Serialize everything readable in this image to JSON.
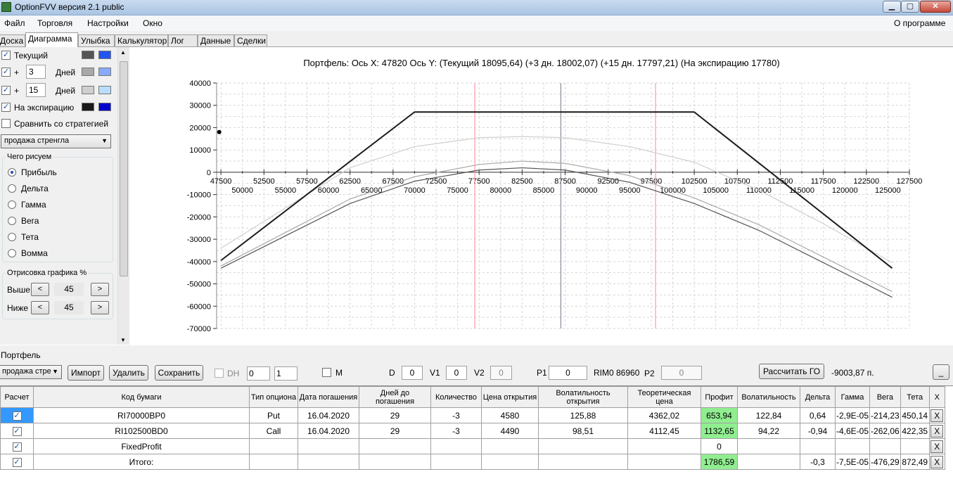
{
  "window": {
    "title": "OptionFVV версия 2.1 public",
    "min_glyph": "▁",
    "max_glyph": "▢",
    "close_glyph": "✕"
  },
  "menu": {
    "items": [
      "Файл",
      "Торговля",
      "Настройки",
      "Окно"
    ],
    "about": "О программе"
  },
  "tabs": [
    "Доска",
    "Диаграмма",
    "Улыбка",
    "Калькулятор",
    "Лог",
    "Данные",
    "Сделки"
  ],
  "active_tab": "Диаграмма",
  "left_panel": {
    "current_label": "Текущий",
    "plus_label": "+",
    "days_label": "Дней",
    "days1": "3",
    "days2": "15",
    "expiry_label": "На экспирацию",
    "compare_label": "Сравнить со стратегией",
    "strategy_value": "продажа стренгла",
    "what_group": "Чего рисуем",
    "options": [
      "Прибыль",
      "Дельта",
      "Гамма",
      "Вега",
      "Тета",
      "Вомма"
    ],
    "selected": "Прибыль",
    "draw_group": "Отрисовка графика %",
    "above_label": "Выше",
    "below_label": "Ниже",
    "above_value": "45",
    "below_value": "45",
    "dec": "<",
    "inc": ">",
    "swatches": {
      "current": [
        "#555555",
        "#2255ee"
      ],
      "d3": [
        "#a8a8a8",
        "#88aaff"
      ],
      "d15": [
        "#cfcfcf",
        "#b8ddff"
      ],
      "expiry": [
        "#1a1a1a",
        "#0000cc"
      ]
    }
  },
  "chart_data": {
    "type": "line",
    "title": "Портфель: Ось X: 47820 Ось Y:  (Текущий 18095,64)  (+3 дн. 18002,07)  (+15 дн. 17797,21)  (На экспирацию 17780)",
    "xlim": [
      47000,
      127500
    ],
    "ylim": [
      -70000,
      40000
    ],
    "grid": true,
    "yticks": [
      40000,
      30000,
      20000,
      10000,
      0,
      -10000,
      -20000,
      -30000,
      -40000,
      -50000,
      -60000,
      -70000
    ],
    "ytick_labels": [
      "40000",
      "30000",
      "20000",
      "10000",
      "0",
      "-10000",
      "-20000",
      "-30000",
      "-40000",
      "-50000",
      "-60000",
      "-70000"
    ],
    "xticks_top": [
      47500,
      52500,
      57500,
      62500,
      67500,
      72500,
      77500,
      82500,
      87500,
      92500,
      97500,
      102500,
      107500,
      112500,
      117500,
      122500,
      127500
    ],
    "xtick_labels_top": [
      "47500",
      "52500",
      "57500",
      "62500",
      "67500",
      "72500",
      "77500",
      "82500",
      "87500",
      "92500",
      "97500",
      "102500",
      "107500",
      "112500",
      "117500",
      "122500",
      "127500"
    ],
    "xticks_bottom": [
      50000,
      55000,
      60000,
      65000,
      70000,
      75000,
      80000,
      85000,
      90000,
      95000,
      100000,
      105000,
      110000,
      115000,
      120000,
      125000
    ],
    "xtick_labels_bottom": [
      "50000",
      "55000",
      "60000",
      "65000",
      "70000",
      "75000",
      "80000",
      "85000",
      "90000",
      "95000",
      "100000",
      "105000",
      "110000",
      "115000",
      "120000",
      "125000"
    ],
    "vlines": [
      {
        "x": 77000,
        "color": "#ff9aa8"
      },
      {
        "x": 87000,
        "color": "#8a8a9a"
      },
      {
        "x": 98000,
        "color": "#ff9aa8"
      }
    ],
    "marker": {
      "x": 47300,
      "y": 18000
    },
    "series": [
      {
        "color": "#1a1a1a",
        "points": [
          [
            47500,
            -39500
          ],
          [
            70000,
            27000
          ],
          [
            102500,
            27000
          ],
          [
            125500,
            -43000
          ]
        ]
      },
      {
        "color": "#555555",
        "points": [
          [
            47500,
            -43000
          ],
          [
            55000,
            -28500
          ],
          [
            62500,
            -14000
          ],
          [
            70000,
            -4000
          ],
          [
            77500,
            1000
          ],
          [
            82500,
            2000
          ],
          [
            87500,
            1000
          ],
          [
            95000,
            -4500
          ],
          [
            102500,
            -14000
          ],
          [
            110000,
            -26000
          ],
          [
            117500,
            -40500
          ],
          [
            125500,
            -56000
          ]
        ]
      },
      {
        "color": "#a8a8a8",
        "points": [
          [
            47500,
            -42000
          ],
          [
            55000,
            -27000
          ],
          [
            62500,
            -12000
          ],
          [
            70000,
            -2000
          ],
          [
            77500,
            3500
          ],
          [
            82500,
            5000
          ],
          [
            87500,
            4000
          ],
          [
            95000,
            -1500
          ],
          [
            102500,
            -11500
          ],
          [
            110000,
            -23500
          ],
          [
            117500,
            -38000
          ],
          [
            125500,
            -53500
          ]
        ]
      },
      {
        "color": "#cfcfcf",
        "points": [
          [
            47500,
            -34000
          ],
          [
            55000,
            -16000
          ],
          [
            62500,
            2000
          ],
          [
            70000,
            11500
          ],
          [
            77500,
            15500
          ],
          [
            82500,
            16000
          ],
          [
            87500,
            15500
          ],
          [
            95000,
            11500
          ],
          [
            102500,
            4500
          ],
          [
            110000,
            -8000
          ],
          [
            117500,
            -23000
          ],
          [
            125500,
            -40500
          ]
        ]
      }
    ]
  },
  "bottom": {
    "group": "Портфель",
    "portfolio_value": "продажа стре",
    "import_label": "Импорт",
    "delete_label": "Удалить",
    "save_label": "Сохранить",
    "dh_label": "DH",
    "dh_value1": "0",
    "dh_value2": "1",
    "m_label": "M",
    "d_label": "D",
    "d_value": "0",
    "v1_label": "V1",
    "v1_value": "0",
    "v2_label": "V2",
    "v2_value": "0",
    "p1_label": "P1",
    "p1_value": "0",
    "rim_label": "RIM0 86960",
    "p2_label": "P2",
    "p2_value": "0",
    "calc_label": "Рассчитать ГО",
    "go_value": "-9003,87 п.",
    "collapse_label": "_"
  },
  "grid": {
    "headers": [
      "Расчет",
      "Код бумаги",
      "Тип опциона",
      "Дата погашения",
      "Дней до погашения",
      "Количество",
      "Цена открытия",
      "Волатильность открытия",
      "Теоретическая цена",
      "Профит",
      "Волатильность",
      "Дельта",
      "Гамма",
      "Вега",
      "Тета",
      "X"
    ],
    "rows": [
      {
        "code": "RI70000BP0",
        "type": "Put",
        "date": "16.04.2020",
        "days": "29",
        "qty": "-3",
        "price": "4580",
        "vol_open": "125,88",
        "theor": "4362,02",
        "profit": "653,94",
        "vol": "122,84",
        "delta": "0,64",
        "gamma": "-2,9E-05",
        "vega": "-214,23",
        "theta": "450,14",
        "x": "X"
      },
      {
        "code": "RI102500BD0",
        "type": "Call",
        "date": "16.04.2020",
        "days": "29",
        "qty": "-3",
        "price": "4490",
        "vol_open": "98,51",
        "theor": "4112,45",
        "profit": "1132,65",
        "vol": "94,22",
        "delta": "-0,94",
        "gamma": "-4,6E-05",
        "vega": "-262,06",
        "theta": "422,35",
        "x": "X"
      },
      {
        "code": "FixedProfit",
        "type": "",
        "date": "",
        "days": "",
        "qty": "",
        "price": "",
        "vol_open": "",
        "theor": "",
        "profit": "0",
        "vol": "",
        "delta": "",
        "gamma": "",
        "vega": "",
        "theta": "",
        "x": "X"
      },
      {
        "code": "Итого:",
        "type": "",
        "date": "",
        "days": "",
        "qty": "",
        "price": "",
        "vol_open": "",
        "theor": "",
        "profit": "1786,59",
        "vol": "",
        "delta": "-0,3",
        "gamma": "-7,5E-05",
        "vega": "-476,29",
        "theta": "872,49",
        "x": "X"
      }
    ],
    "check_glyph": "✓",
    "profit_color": "#90ee90"
  }
}
